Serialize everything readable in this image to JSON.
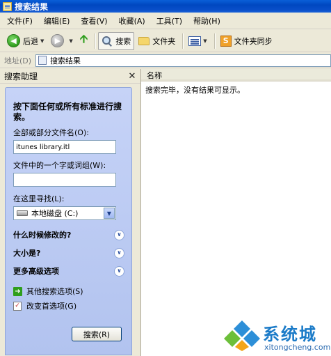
{
  "window": {
    "title": "搜索结果"
  },
  "menu": {
    "items": [
      "文件(F)",
      "编辑(E)",
      "查看(V)",
      "收藏(A)",
      "工具(T)",
      "帮助(H)"
    ]
  },
  "toolbar": {
    "back_label": "后退",
    "search_label": "搜索",
    "folders_label": "文件夹",
    "sync_label": "文件夹同步"
  },
  "address": {
    "label": "地址(D)",
    "value": "搜索结果"
  },
  "assistant": {
    "pane_title": "搜索助理",
    "heading": "按下面任何或所有标准进行搜索。",
    "name_label": "全部或部分文件名(O):",
    "name_value": "itunes library.itl",
    "phrase_label": "文件中的一个字或词组(W):",
    "phrase_value": "",
    "look_in_label": "在这里寻找(L):",
    "look_in_value": "本地磁盘 (C:)",
    "when_modified": "什么时候修改的?",
    "size_label": "大小是?",
    "advanced_label": "更多高级选项",
    "other_options": "其他搜索选项(S)",
    "change_prefs": "改变首选项(G)",
    "search_button": "搜索(R)"
  },
  "results": {
    "column_name": "名称",
    "message": "搜索完毕，没有结果可显示。"
  },
  "watermark": {
    "text": "系统城",
    "url": "xitongcheng.com"
  }
}
